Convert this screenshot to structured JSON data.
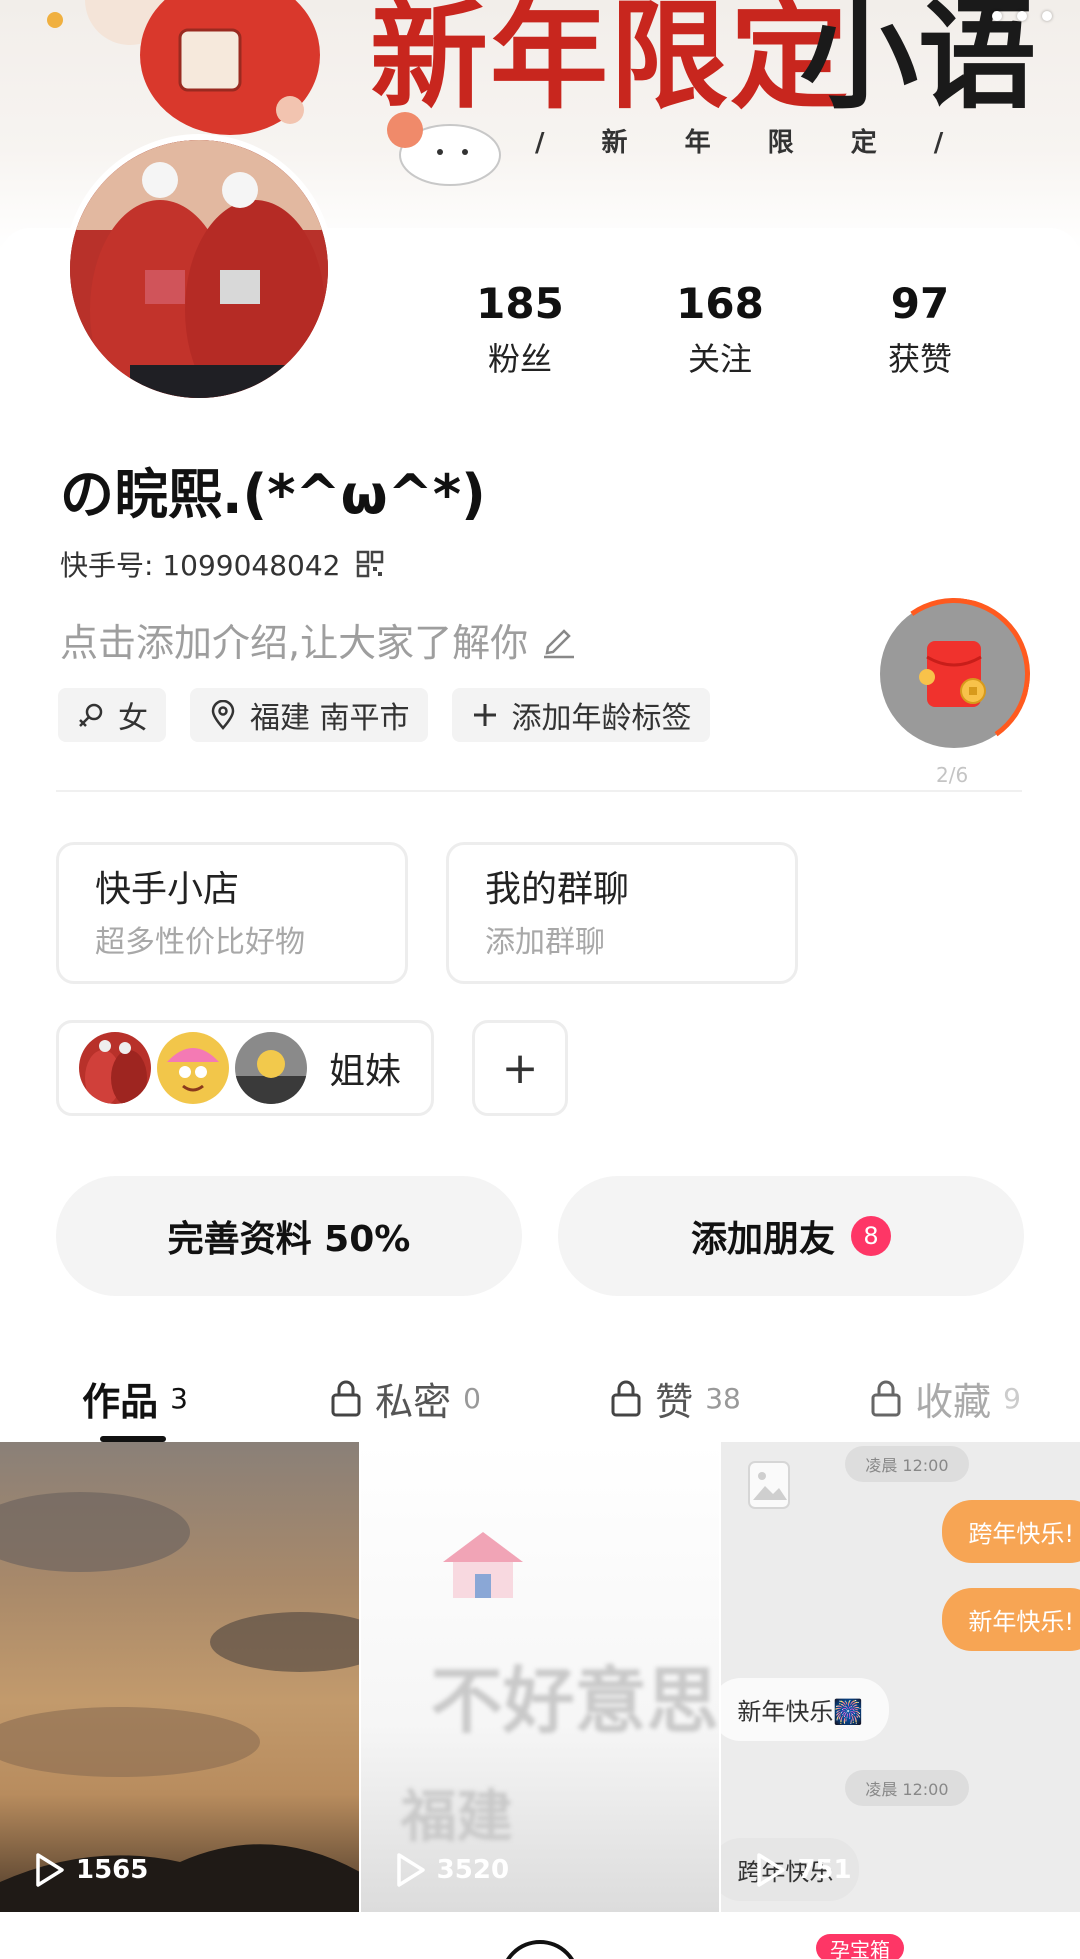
{
  "banner": {
    "title_red": "新年限定",
    "title_black": "小语",
    "subtitle": "/ 新 年 限 定 /"
  },
  "stats": [
    {
      "value": "185",
      "label": "粉丝"
    },
    {
      "value": "168",
      "label": "关注"
    },
    {
      "value": "97",
      "label": "获赞"
    }
  ],
  "profile": {
    "nickname": "の睆熙.(*^ω^*)",
    "uid_label": "快手号: 1099048042",
    "intro_placeholder": "点击添加介绍,让大家了解你",
    "tags": {
      "gender": "女",
      "location": "福建 南平市",
      "add_age": "添加年龄标签"
    }
  },
  "redpack": {
    "progress_text": "2/6",
    "progress": 0.33,
    "accent": "#ff5a1f"
  },
  "entries": [
    {
      "title": "快手小店",
      "subtitle": "超多性价比好物"
    },
    {
      "title": "我的群聊",
      "subtitle": "添加群聊"
    }
  ],
  "group": {
    "name": "姐妹",
    "add_label": "+"
  },
  "actions": {
    "complete_profile": "完善资料 50%",
    "add_friends": "添加朋友",
    "add_friends_badge": "8",
    "badge_color": "#fe3666"
  },
  "tabs": [
    {
      "label": "作品",
      "count": "3",
      "locked": false,
      "active": true
    },
    {
      "label": "私密",
      "count": "0",
      "locked": true,
      "active": false
    },
    {
      "label": "赞",
      "count": "38",
      "locked": true,
      "active": false
    },
    {
      "label": "收藏",
      "count": "9",
      "locked": true,
      "active": false
    }
  ],
  "videos": [
    {
      "play_count": "1565"
    },
    {
      "play_count": "3520",
      "blurred_line1": "不好意思",
      "blurred_line2": "福建"
    },
    {
      "play_count": "751",
      "chat": {
        "time1": "凌晨 12:00",
        "me1": "跨年快乐!",
        "me2": "新年快乐!",
        "them1": "新年快乐🎆",
        "time2": "凌晨 12:00",
        "them2": "跨年快乐"
      }
    }
  ],
  "bottom": {
    "tag_label": "孕宝箱"
  },
  "icons": {
    "more": "more-dots-icon",
    "qr": "qrcode-icon",
    "edit": "pencil-icon",
    "gender": "female-icon",
    "location": "location-pin-icon",
    "plus": "plus-icon",
    "lock": "lock-icon",
    "play": "play-icon"
  }
}
